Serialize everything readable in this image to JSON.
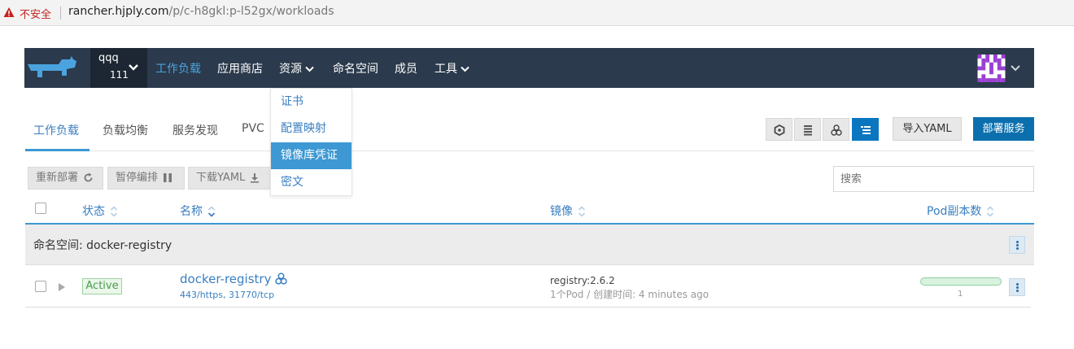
{
  "browser": {
    "security_label": "不安全",
    "url_host": "rancher.hjply.com",
    "url_path": "/p/c-h8gkl:p-l52gx/workloads"
  },
  "nav": {
    "project_name": "qqq",
    "project_sub": "111",
    "items": [
      "工作负载",
      "应用商店",
      "资源",
      "命名空间",
      "成员",
      "工具"
    ]
  },
  "resources_menu": {
    "items": [
      "证书",
      "配置映射",
      "镜像库凭证",
      "密文"
    ],
    "selected": "镜像库凭证"
  },
  "tabs": [
    "工作负载",
    "负载均衡",
    "服务发现",
    "PVC"
  ],
  "buttons": {
    "import_yaml": "导入YAML",
    "deploy": "部署服务"
  },
  "view_icons": [
    "node-icon",
    "list-icon",
    "cluster-icon",
    "tree-list-icon"
  ],
  "actions": {
    "redeploy": "重新部署",
    "pause": "暂停编排",
    "download": "下载YAML"
  },
  "search": {
    "placeholder": "搜索"
  },
  "table": {
    "headers": {
      "status": "状态",
      "name": "名称",
      "image": "镜像",
      "pods": "Pod副本数"
    }
  },
  "group": {
    "label": "命名空间: docker-registry"
  },
  "rows": [
    {
      "status": "Active",
      "name": "docker-registry",
      "ports": "443/https, 31770/tcp",
      "image": "registry:2.6.2",
      "meta": "1个Pod / 创建时间: 4 minutes ago",
      "pod_count": "1",
      "pod_fraction": 1.0
    }
  ],
  "colors": {
    "nav_bg": "#2b3a4c",
    "accent": "#3d98d3",
    "primary_button": "#0b6fae"
  }
}
